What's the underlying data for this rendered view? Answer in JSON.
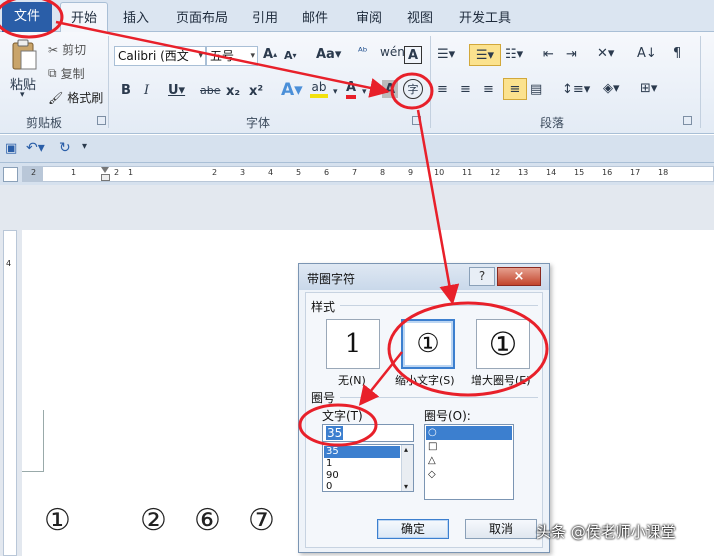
{
  "tabs": {
    "file": "文件",
    "items": [
      "开始",
      "插入",
      "页面布局",
      "引用",
      "邮件",
      "审阅",
      "视图",
      "开发工具"
    ]
  },
  "ribbon": {
    "clipboard": {
      "label": "剪贴板",
      "paste": "粘贴",
      "cut": "剪切",
      "copy": "复制",
      "format_painter": "格式刷"
    },
    "font": {
      "label": "字体",
      "font_name": "Calibri (西文",
      "font_size": "五号"
    },
    "paragraph": {
      "label": "段落"
    }
  },
  "ruler_numbers": [
    "2",
    "1",
    "1",
    "2",
    "1",
    "2",
    "3",
    "4",
    "5",
    "6",
    "7",
    "8",
    "9",
    "10",
    "11",
    "12",
    "13",
    "14",
    "15",
    "16",
    "17",
    "18"
  ],
  "vruler_number": "4",
  "document": {
    "circled_chars": [
      "①",
      "②",
      "⑥",
      "⑦"
    ]
  },
  "dialog": {
    "title": "带圈字符",
    "help": "?",
    "close": "×",
    "style_section": "样式",
    "styles": [
      {
        "glyph": "1",
        "caption": "无(N)"
      },
      {
        "glyph": "①",
        "caption": "缩小文字(S)"
      },
      {
        "glyph": "①",
        "caption": "增大圈号(E)"
      }
    ],
    "circle_section": "圈号",
    "text_label": "文字(T)",
    "text_value": "35",
    "text_list": [
      "35",
      "1",
      "90",
      "0"
    ],
    "enclosure_label": "圈号(O):",
    "enclosure_list": [
      "○",
      "□",
      "△",
      "◇"
    ],
    "ok": "确定",
    "cancel": "取消"
  },
  "watermark": "头条 @侯老师小课堂",
  "colors": {
    "file_tab": "#2a5ea8",
    "annotation_red": "#e8202a",
    "selection_blue": "#3c7fcf"
  }
}
